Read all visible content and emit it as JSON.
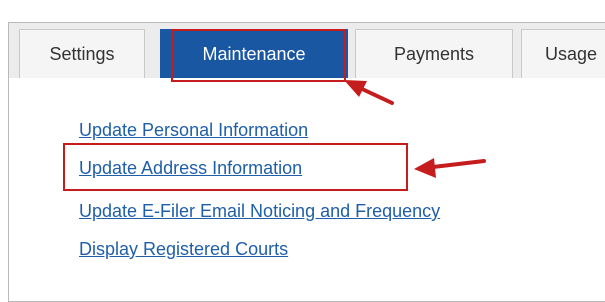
{
  "tabs": {
    "settings": "Settings",
    "maintenance": "Maintenance",
    "payments": "Payments",
    "usage": "Usage"
  },
  "links": [
    "Update Personal Information",
    "Update Address Information",
    "Update E-Filer Email Noticing and Frequency",
    "Display Registered Courts"
  ],
  "colors": {
    "active_tab": "#1a57a3",
    "link": "#1f5fa8",
    "annotation": "#c51d1d"
  },
  "icons": {
    "tab_arrow": "arrow-icon",
    "link_arrow": "arrow-icon"
  }
}
